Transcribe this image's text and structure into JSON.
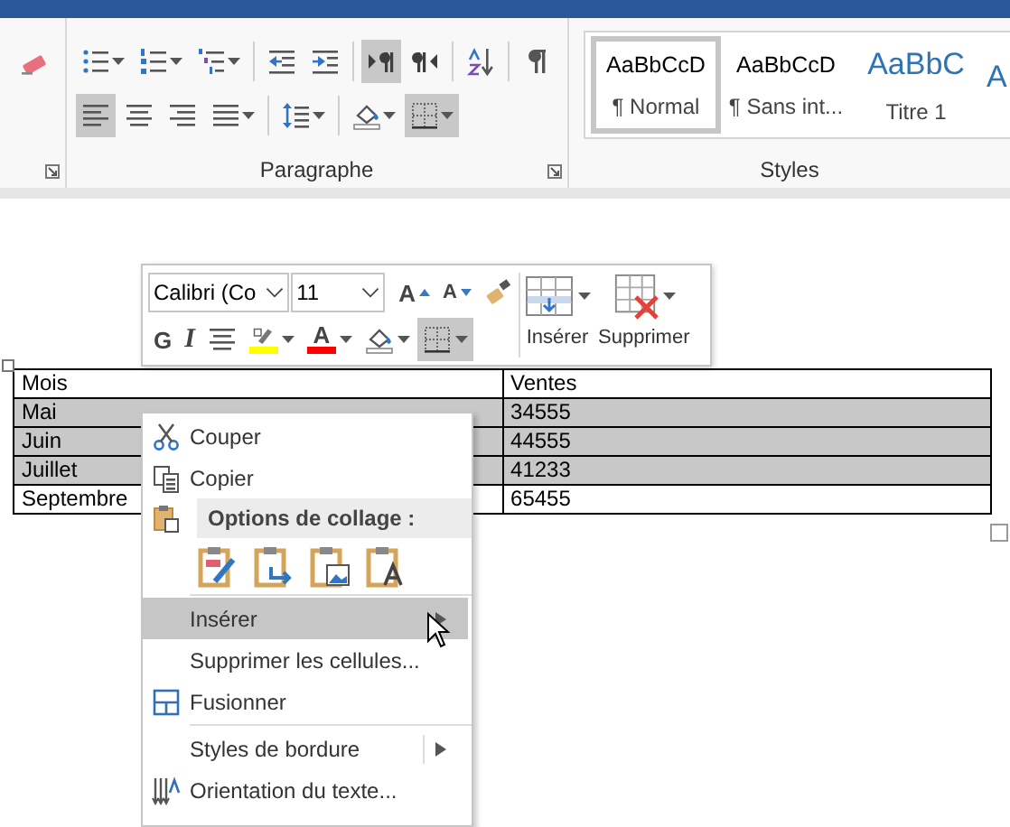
{
  "ribbon": {
    "edit_tools": [
      {
        "kind": "clear-format",
        "selected": false
      }
    ],
    "paragraph": {
      "label": "Paragraphe",
      "rows": [
        [
          {
            "kind": "bullets",
            "caret": true,
            "selected": false
          },
          {
            "kind": "numbering",
            "caret": true,
            "selected": false
          },
          {
            "kind": "multilevel",
            "caret": true,
            "selected": false
          },
          {
            "kind": "sep"
          },
          {
            "kind": "outdent",
            "caret": false,
            "selected": false
          },
          {
            "kind": "indent",
            "caret": false,
            "selected": false
          },
          {
            "kind": "sep"
          },
          {
            "kind": "ltr",
            "caret": false,
            "selected": true
          },
          {
            "kind": "rtl",
            "caret": false,
            "selected": false
          },
          {
            "kind": "sep"
          },
          {
            "kind": "sort",
            "caret": false,
            "selected": false
          },
          {
            "kind": "sep"
          },
          {
            "kind": "pilcrow",
            "caret": false,
            "selected": false
          }
        ],
        [
          {
            "kind": "align-left",
            "caret": false,
            "selected": true
          },
          {
            "kind": "align-center",
            "caret": false,
            "selected": false
          },
          {
            "kind": "align-right",
            "caret": false,
            "selected": false
          },
          {
            "kind": "justify",
            "caret": true,
            "selected": false
          },
          {
            "kind": "sep"
          },
          {
            "kind": "spacing",
            "caret": true,
            "selected": false
          },
          {
            "kind": "sep"
          },
          {
            "kind": "shading",
            "caret": true,
            "selected": false
          },
          {
            "kind": "borders",
            "caret": true,
            "selected": true
          }
        ]
      ]
    },
    "styles": {
      "label": "Styles",
      "items": [
        {
          "preview": "AaBbCcD",
          "name": "¶ Normal",
          "kind": "body",
          "selected": true
        },
        {
          "preview": "AaBbCcD",
          "name": "¶ Sans int...",
          "kind": "body",
          "selected": false
        },
        {
          "preview": "AaBbC",
          "name": "Titre 1",
          "kind": "heading",
          "selected": false
        },
        {
          "preview": "A",
          "kind": "heading",
          "selected": false
        }
      ]
    }
  },
  "table": {
    "columns": [
      "Mois",
      "Ventes"
    ],
    "rows": [
      {
        "cells": [
          "Mai",
          "34555"
        ],
        "selected": true
      },
      {
        "cells": [
          "Juin",
          "44555"
        ],
        "selected": true
      },
      {
        "cells": [
          "Juillet",
          "41233"
        ],
        "selected": true
      },
      {
        "cells": [
          "Septembre",
          "65455"
        ],
        "selected": false
      }
    ]
  },
  "mini_toolbar": {
    "font": "Calibri (Co",
    "size": "11",
    "row1": [
      {
        "kind": "grow",
        "glyph": "A"
      },
      {
        "kind": "shrink",
        "glyph": "A"
      },
      {
        "kind": "painter"
      }
    ],
    "row2": [
      {
        "kind": "bold",
        "glyph": "G",
        "caret": false,
        "selected": false
      },
      {
        "kind": "italic",
        "glyph": "I",
        "caret": false,
        "selected": false
      },
      {
        "kind": "center",
        "caret": false,
        "selected": false
      },
      {
        "kind": "highlight",
        "caret": true,
        "selected": false,
        "color": "#ffff00"
      },
      {
        "kind": "font-color",
        "glyph": "A",
        "caret": true,
        "selected": false,
        "color": "#ff0000"
      },
      {
        "kind": "shading",
        "caret": true,
        "selected": false
      },
      {
        "kind": "borders",
        "caret": true,
        "selected": true
      }
    ],
    "actions": [
      {
        "kind": "insert",
        "label": "Insérer"
      },
      {
        "kind": "delete",
        "label": "Supprimer"
      }
    ]
  },
  "context_menu": {
    "items": [
      {
        "kind": "cut",
        "label": "Couper",
        "highlighted": false,
        "submenu": false
      },
      {
        "kind": "copy",
        "label": "Copier",
        "highlighted": false,
        "submenu": false
      },
      {
        "kind": "paste-header",
        "label": "Options de collage :"
      },
      {
        "kind": "paste-options",
        "options": [
          {
            "kind": "keep-format"
          },
          {
            "kind": "merge"
          },
          {
            "kind": "picture"
          },
          {
            "kind": "text"
          }
        ]
      },
      {
        "kind": "separator"
      },
      {
        "kind": "insert",
        "label": "Insérer",
        "highlighted": true,
        "submenu": true
      },
      {
        "kind": "delete-cells",
        "label": "Supprimer les cellules...",
        "highlighted": false,
        "submenu": false
      },
      {
        "kind": "merge",
        "label": "Fusionner",
        "highlighted": false,
        "submenu": false
      },
      {
        "kind": "separator"
      },
      {
        "kind": "border-styles",
        "label": "Styles de bordure",
        "highlighted": false,
        "submenu": true,
        "split": true
      },
      {
        "kind": "text-direction",
        "label": "Orientation du texte...",
        "highlighted": false,
        "submenu": false
      }
    ]
  }
}
